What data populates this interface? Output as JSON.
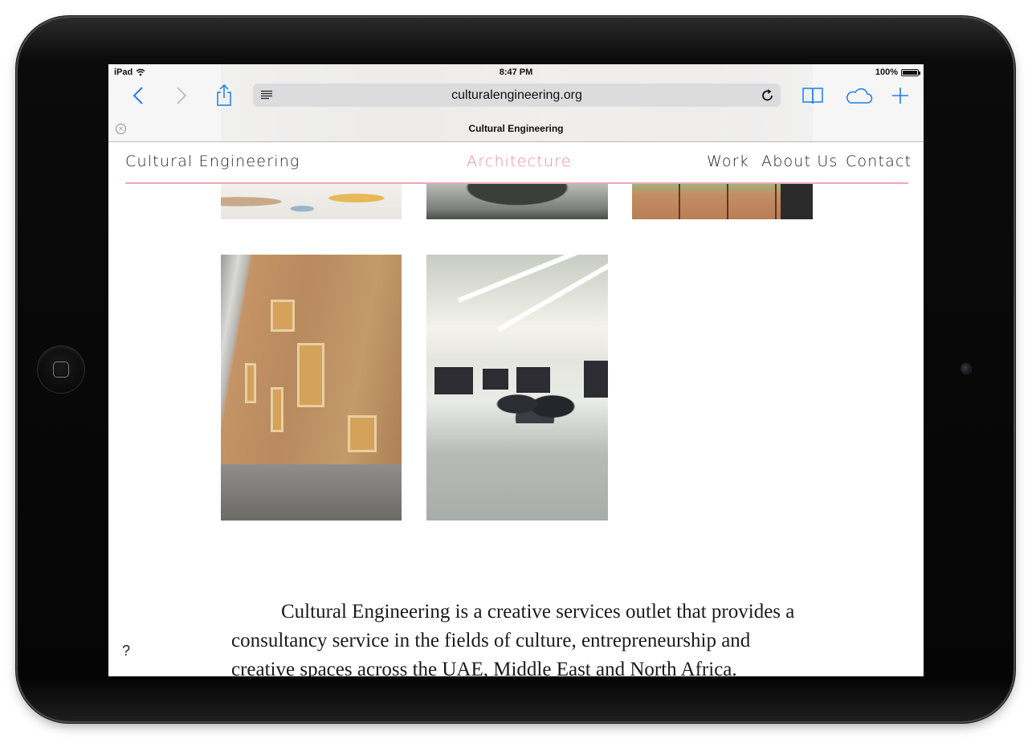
{
  "status_bar": {
    "device": "iPad",
    "time": "8:47 PM",
    "battery_label": "100%",
    "battery_level": 1.0
  },
  "browser": {
    "url": "culturalengineering.org",
    "tab_title": "Cultural Engineering",
    "accent_color": "#1b7cf6",
    "icons": {
      "back": "chevron-left-icon",
      "forward": "chevron-right-icon",
      "share": "share-icon",
      "reader": "reader-icon",
      "reload": "reload-icon",
      "bookmarks": "bookmarks-icon",
      "icloud_tabs": "cloud-icon",
      "new_tab": "plus-icon",
      "close_tab": "close-icon"
    }
  },
  "site": {
    "brand": "Cultural Engineering",
    "nav": {
      "architecture": "Architecture",
      "work": "Work",
      "about": "About Us",
      "contact": "Contact"
    },
    "accent_color": "#ee8a9a",
    "about_text": "Cultural Engineering is a creative services outlet that provides a consultancy service in the fields of culture, entrepreneurship and creative spaces across the UAE, Middle East and North Africa.",
    "help_mark": "?"
  }
}
